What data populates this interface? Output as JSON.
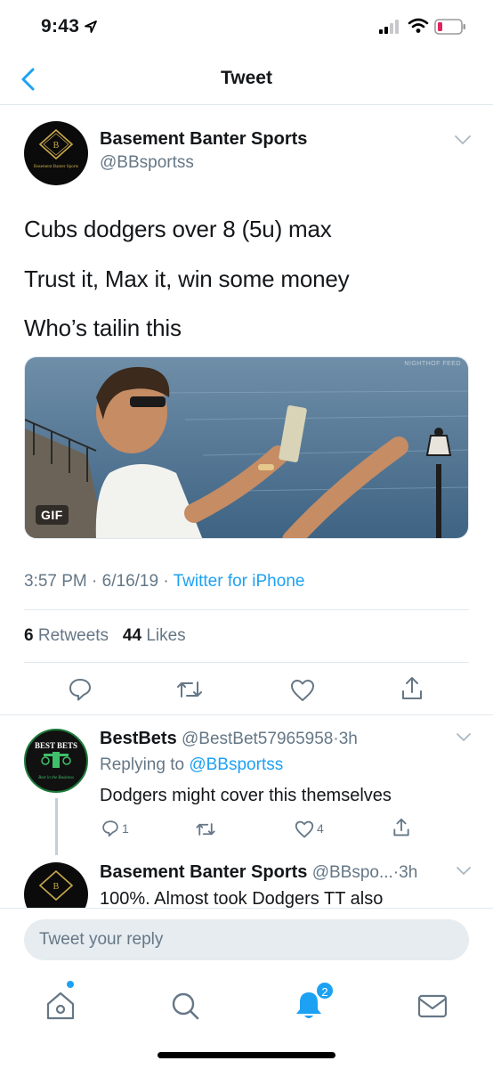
{
  "status_bar": {
    "time": "9:43",
    "icons": [
      "location-arrow-icon",
      "signal-icon",
      "wifi-icon",
      "battery-low-icon"
    ],
    "battery_color": "#e0245e"
  },
  "nav": {
    "title": "Tweet",
    "back_icon": "chevron-left-icon"
  },
  "tweet": {
    "author_name": "Basement Banter Sports",
    "author_handle": "@BBsportss",
    "avatar_text": "Basement Banter Sports",
    "avatar_monogram": "B",
    "lines": [
      "Cubs dodgers over 8 (5u) max",
      "Trust it, Max it, win some money",
      "Who’s tailin this"
    ],
    "media_badge": "GIF",
    "media_watermark": "NIGHTHOF FEED",
    "time": "3:57 PM",
    "date": "6/16/19",
    "separator": "·",
    "source": "Twitter for iPhone",
    "retweets_count": "6",
    "retweets_label": "Retweets",
    "likes_count": "44",
    "likes_label": "Likes",
    "actions": [
      "reply-icon",
      "retweet-icon",
      "like-icon",
      "share-icon"
    ]
  },
  "replies": [
    {
      "name": "BestBets",
      "handle": "@BestBet57965958",
      "time": "3h",
      "replying_prefix": "Replying to",
      "replying_to": "@BBsportss",
      "text": "Dodgers might cover this themselves",
      "avatar_top": "BEST BETS",
      "avatar_bottom": "Best in the Business",
      "reply_count": "1",
      "like_count": "4"
    },
    {
      "name": "Basement Banter Sports",
      "handle": "@BBspo...",
      "time": "3h",
      "text": "100%. Almost took Dodgers TT also"
    }
  ],
  "compose": {
    "placeholder": "Tweet your reply"
  },
  "tab_bar": {
    "tabs": [
      "home-icon",
      "search-icon",
      "notifications-icon",
      "messages-icon"
    ],
    "notification_badge": "2",
    "accent": "#1da1f2"
  }
}
